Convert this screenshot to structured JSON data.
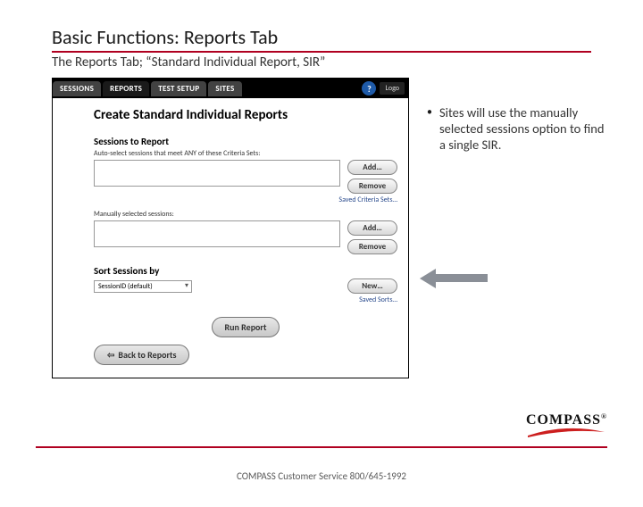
{
  "title": "Basic Functions: Reports Tab",
  "subtitle": "The Reports Tab; “Standard Individual Report, SIR”",
  "tabs": {
    "t0": "SESSIONS",
    "t1": "REPORTS",
    "t2": "TEST SETUP",
    "t3": "SITES"
  },
  "help": "?",
  "logo_chip": "Logo",
  "app": {
    "heading": "Create Standard Individual Reports",
    "sessions_label": "Sessions to Report",
    "auto_label": "Auto-select sessions that meet ANY of these Criteria Sets:",
    "add": "Add…",
    "remove": "Remove",
    "saved_sets": "Saved Criteria Sets…",
    "manual_label": "Manually selected sessions:",
    "sort_label": "Sort Sessions by",
    "sort_value": "SessionID (default)",
    "new": "New…",
    "saved_sorts": "Saved Sorts…",
    "run": "Run Report",
    "back": "Back to Reports"
  },
  "bullet_text": "Sites will use the manually selected sessions option to find a single SIR.",
  "brand": "COMPASS",
  "reg": "®",
  "footer": "COMPASS Customer Service 800/645-1992"
}
